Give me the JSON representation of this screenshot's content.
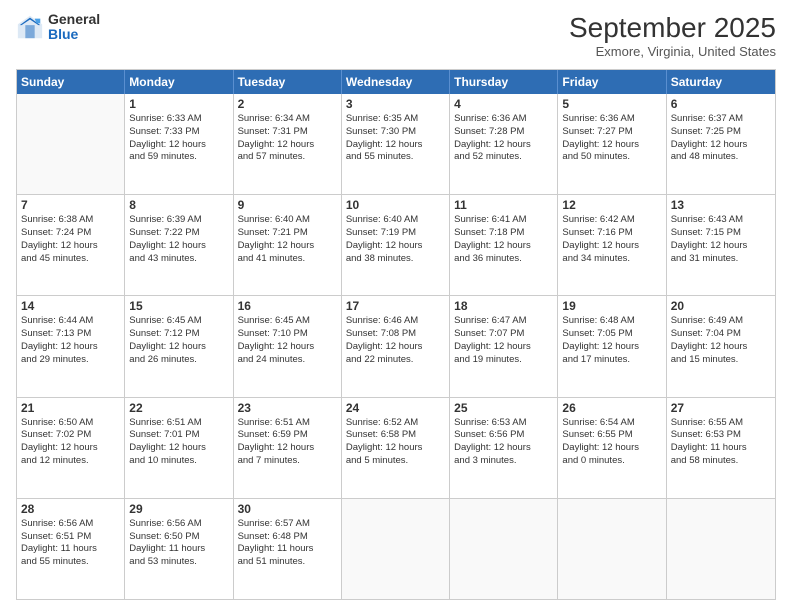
{
  "logo": {
    "general": "General",
    "blue": "Blue"
  },
  "header": {
    "month": "September 2025",
    "location": "Exmore, Virginia, United States"
  },
  "weekdays": [
    "Sunday",
    "Monday",
    "Tuesday",
    "Wednesday",
    "Thursday",
    "Friday",
    "Saturday"
  ],
  "weeks": [
    [
      {
        "day": "",
        "info": ""
      },
      {
        "day": "1",
        "info": "Sunrise: 6:33 AM\nSunset: 7:33 PM\nDaylight: 12 hours\nand 59 minutes."
      },
      {
        "day": "2",
        "info": "Sunrise: 6:34 AM\nSunset: 7:31 PM\nDaylight: 12 hours\nand 57 minutes."
      },
      {
        "day": "3",
        "info": "Sunrise: 6:35 AM\nSunset: 7:30 PM\nDaylight: 12 hours\nand 55 minutes."
      },
      {
        "day": "4",
        "info": "Sunrise: 6:36 AM\nSunset: 7:28 PM\nDaylight: 12 hours\nand 52 minutes."
      },
      {
        "day": "5",
        "info": "Sunrise: 6:36 AM\nSunset: 7:27 PM\nDaylight: 12 hours\nand 50 minutes."
      },
      {
        "day": "6",
        "info": "Sunrise: 6:37 AM\nSunset: 7:25 PM\nDaylight: 12 hours\nand 48 minutes."
      }
    ],
    [
      {
        "day": "7",
        "info": "Sunrise: 6:38 AM\nSunset: 7:24 PM\nDaylight: 12 hours\nand 45 minutes."
      },
      {
        "day": "8",
        "info": "Sunrise: 6:39 AM\nSunset: 7:22 PM\nDaylight: 12 hours\nand 43 minutes."
      },
      {
        "day": "9",
        "info": "Sunrise: 6:40 AM\nSunset: 7:21 PM\nDaylight: 12 hours\nand 41 minutes."
      },
      {
        "day": "10",
        "info": "Sunrise: 6:40 AM\nSunset: 7:19 PM\nDaylight: 12 hours\nand 38 minutes."
      },
      {
        "day": "11",
        "info": "Sunrise: 6:41 AM\nSunset: 7:18 PM\nDaylight: 12 hours\nand 36 minutes."
      },
      {
        "day": "12",
        "info": "Sunrise: 6:42 AM\nSunset: 7:16 PM\nDaylight: 12 hours\nand 34 minutes."
      },
      {
        "day": "13",
        "info": "Sunrise: 6:43 AM\nSunset: 7:15 PM\nDaylight: 12 hours\nand 31 minutes."
      }
    ],
    [
      {
        "day": "14",
        "info": "Sunrise: 6:44 AM\nSunset: 7:13 PM\nDaylight: 12 hours\nand 29 minutes."
      },
      {
        "day": "15",
        "info": "Sunrise: 6:45 AM\nSunset: 7:12 PM\nDaylight: 12 hours\nand 26 minutes."
      },
      {
        "day": "16",
        "info": "Sunrise: 6:45 AM\nSunset: 7:10 PM\nDaylight: 12 hours\nand 24 minutes."
      },
      {
        "day": "17",
        "info": "Sunrise: 6:46 AM\nSunset: 7:08 PM\nDaylight: 12 hours\nand 22 minutes."
      },
      {
        "day": "18",
        "info": "Sunrise: 6:47 AM\nSunset: 7:07 PM\nDaylight: 12 hours\nand 19 minutes."
      },
      {
        "day": "19",
        "info": "Sunrise: 6:48 AM\nSunset: 7:05 PM\nDaylight: 12 hours\nand 17 minutes."
      },
      {
        "day": "20",
        "info": "Sunrise: 6:49 AM\nSunset: 7:04 PM\nDaylight: 12 hours\nand 15 minutes."
      }
    ],
    [
      {
        "day": "21",
        "info": "Sunrise: 6:50 AM\nSunset: 7:02 PM\nDaylight: 12 hours\nand 12 minutes."
      },
      {
        "day": "22",
        "info": "Sunrise: 6:51 AM\nSunset: 7:01 PM\nDaylight: 12 hours\nand 10 minutes."
      },
      {
        "day": "23",
        "info": "Sunrise: 6:51 AM\nSunset: 6:59 PM\nDaylight: 12 hours\nand 7 minutes."
      },
      {
        "day": "24",
        "info": "Sunrise: 6:52 AM\nSunset: 6:58 PM\nDaylight: 12 hours\nand 5 minutes."
      },
      {
        "day": "25",
        "info": "Sunrise: 6:53 AM\nSunset: 6:56 PM\nDaylight: 12 hours\nand 3 minutes."
      },
      {
        "day": "26",
        "info": "Sunrise: 6:54 AM\nSunset: 6:55 PM\nDaylight: 12 hours\nand 0 minutes."
      },
      {
        "day": "27",
        "info": "Sunrise: 6:55 AM\nSunset: 6:53 PM\nDaylight: 11 hours\nand 58 minutes."
      }
    ],
    [
      {
        "day": "28",
        "info": "Sunrise: 6:56 AM\nSunset: 6:51 PM\nDaylight: 11 hours\nand 55 minutes."
      },
      {
        "day": "29",
        "info": "Sunrise: 6:56 AM\nSunset: 6:50 PM\nDaylight: 11 hours\nand 53 minutes."
      },
      {
        "day": "30",
        "info": "Sunrise: 6:57 AM\nSunset: 6:48 PM\nDaylight: 11 hours\nand 51 minutes."
      },
      {
        "day": "",
        "info": ""
      },
      {
        "day": "",
        "info": ""
      },
      {
        "day": "",
        "info": ""
      },
      {
        "day": "",
        "info": ""
      }
    ]
  ]
}
